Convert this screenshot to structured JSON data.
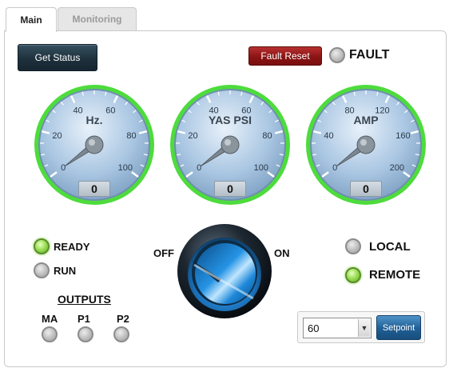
{
  "tabs": [
    {
      "label": "Main",
      "active": true
    },
    {
      "label": "Monitoring",
      "active": false
    }
  ],
  "buttons": {
    "get_status": "Get Status",
    "fault_reset": "Fault Reset",
    "setpoint": "Setpoint"
  },
  "indicators": {
    "fault": {
      "label": "FAULT",
      "on": false
    },
    "ready": {
      "label": "READY",
      "on": true
    },
    "run": {
      "label": "RUN",
      "on": false
    },
    "local": {
      "label": "LOCAL",
      "on": false
    },
    "remote": {
      "label": "REMOTE",
      "on": true
    }
  },
  "gauges": [
    {
      "name": "Hz.",
      "min": 0,
      "max": 100,
      "ticks": [
        "0",
        "20",
        "40",
        "60",
        "80",
        "100"
      ],
      "value": "0"
    },
    {
      "name": "YAS PSI",
      "min": 0,
      "max": 100,
      "ticks": [
        "0",
        "20",
        "40",
        "60",
        "80",
        "100"
      ],
      "value": "0"
    },
    {
      "name": "AMP",
      "min": 0,
      "max": 200,
      "ticks": [
        "0",
        "40",
        "80",
        "120",
        "160",
        "200"
      ],
      "value": "0"
    }
  ],
  "switch": {
    "off_label": "OFF",
    "on_label": "ON",
    "state": "off"
  },
  "outputs": {
    "title": "OUTPUTS",
    "items": [
      {
        "label": "MA",
        "on": false
      },
      {
        "label": "P1",
        "on": false
      },
      {
        "label": "P2",
        "on": false
      }
    ]
  },
  "setpoint": {
    "selected": "60",
    "arrow": "▼"
  },
  "colors": {
    "gauge_ring": "#4ddc3c",
    "gauge_face": "#a9c6e2",
    "knob_blue": "#1e88d8",
    "fault_red": "#8a1414",
    "status_dark": "#1e313d",
    "lamp_green": "#9fe05a"
  }
}
